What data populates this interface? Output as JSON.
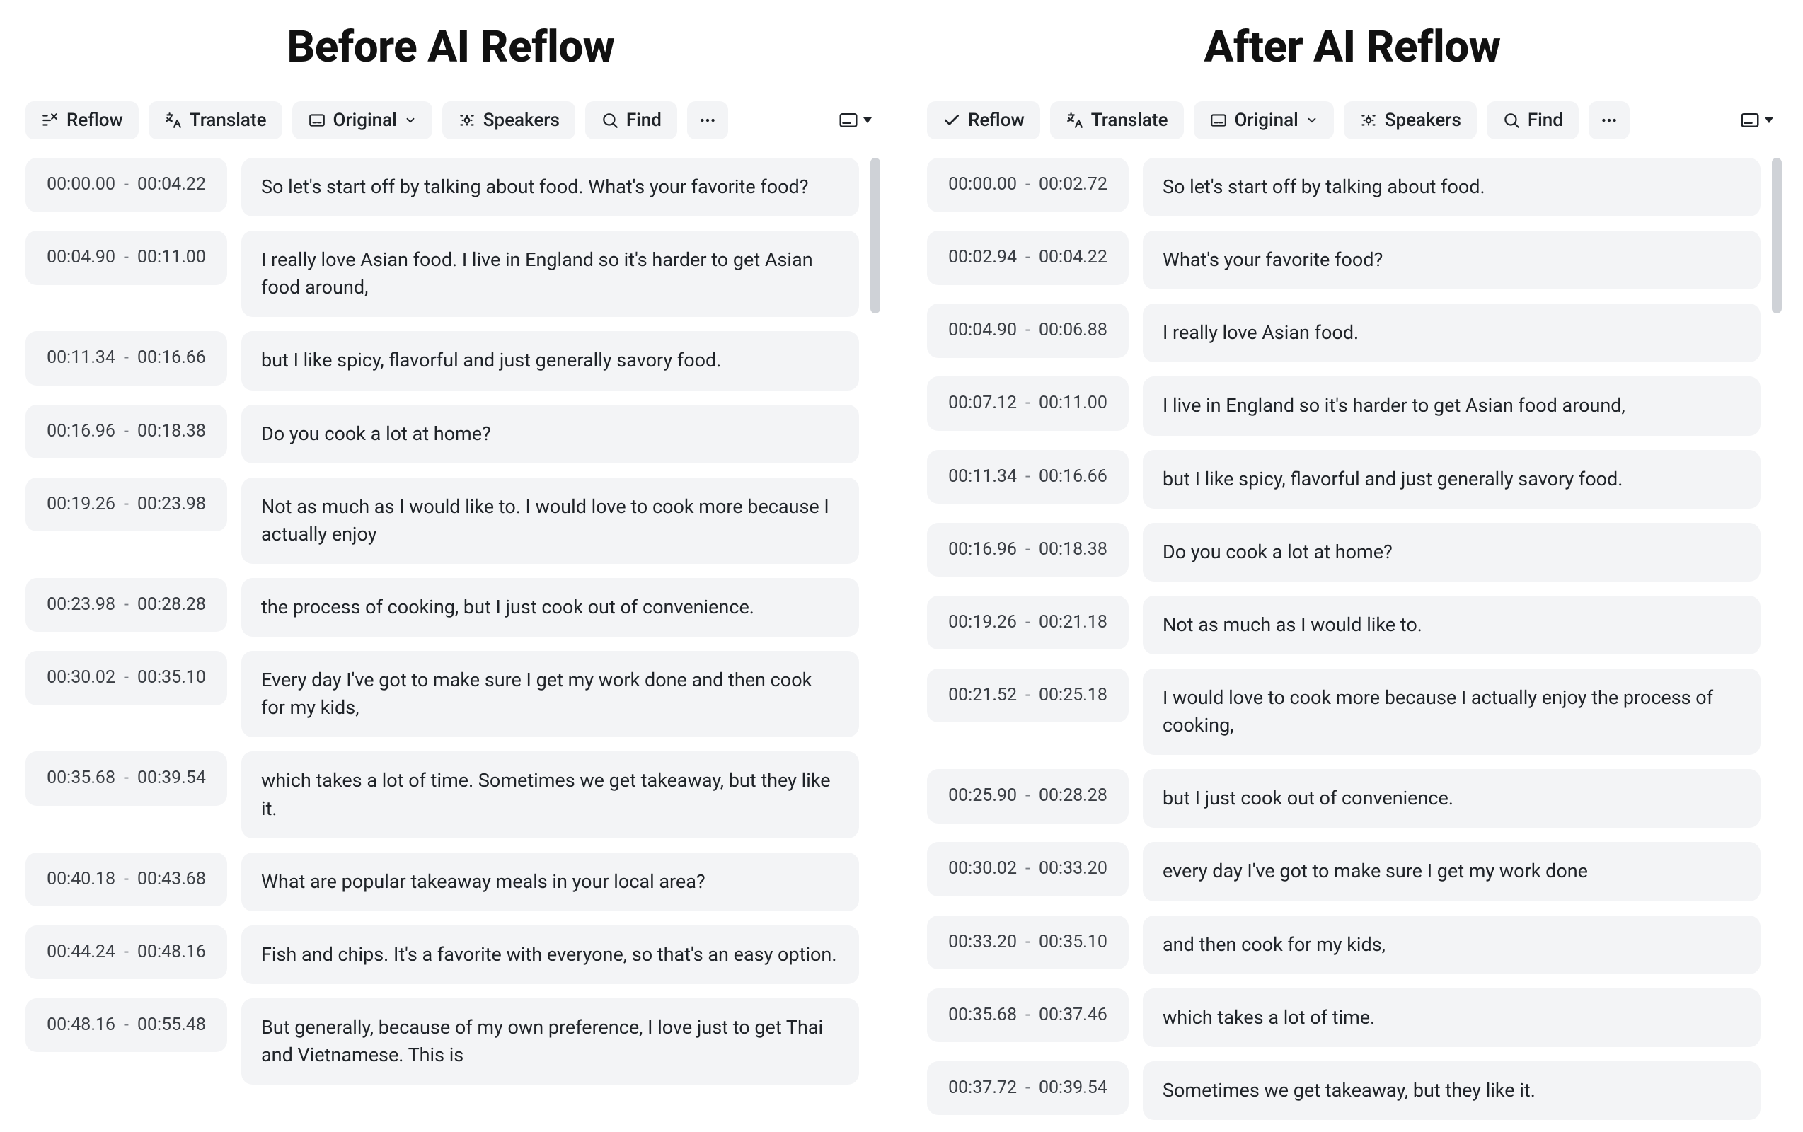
{
  "left": {
    "title": "Before AI Reflow",
    "toolbar": {
      "reflow": "Reflow",
      "translate": "Translate",
      "original": "Original",
      "speakers": "Speakers",
      "find": "Find"
    },
    "rows": [
      {
        "start": "00:00.00",
        "end": "00:04.22",
        "text": "So let's start off by talking about food. What's your favorite food?"
      },
      {
        "start": "00:04.90",
        "end": "00:11.00",
        "text": "I really love Asian food. I live in England so it's harder to get Asian food around,"
      },
      {
        "start": "00:11.34",
        "end": "00:16.66",
        "text": "but I like spicy, flavorful and just generally savory food."
      },
      {
        "start": "00:16.96",
        "end": "00:18.38",
        "text": "Do you cook a lot at home?"
      },
      {
        "start": "00:19.26",
        "end": "00:23.98",
        "text": "Not as much as I would like to. I would love to cook more because I actually enjoy"
      },
      {
        "start": "00:23.98",
        "end": "00:28.28",
        "text": "the process of cooking, but I just cook out of convenience."
      },
      {
        "start": "00:30.02",
        "end": "00:35.10",
        "text": "Every day I've got to make sure I get my work done and then cook for my kids,"
      },
      {
        "start": "00:35.68",
        "end": "00:39.54",
        "text": "which takes a lot of time. Sometimes we get takeaway, but they like it."
      },
      {
        "start": "00:40.18",
        "end": "00:43.68",
        "text": "What are popular takeaway meals in your local area?"
      },
      {
        "start": "00:44.24",
        "end": "00:48.16",
        "text": "Fish and chips. It's a favorite with everyone, so that's an easy option."
      },
      {
        "start": "00:48.16",
        "end": "00:55.48",
        "text": "But generally, because of my own preference, I love just to get Thai and Vietnamese. This is"
      }
    ]
  },
  "right": {
    "title": "After AI Reflow",
    "toolbar": {
      "reflow": "Reflow",
      "translate": "Translate",
      "original": "Original",
      "speakers": "Speakers",
      "find": "Find"
    },
    "rows": [
      {
        "start": "00:00.00",
        "end": "00:02.72",
        "text": "So let's start off by talking about food."
      },
      {
        "start": "00:02.94",
        "end": "00:04.22",
        "text": "What's your favorite food?"
      },
      {
        "start": "00:04.90",
        "end": "00:06.88",
        "text": "I really love Asian food."
      },
      {
        "start": "00:07.12",
        "end": "00:11.00",
        "text": "I live in England so it's harder to get Asian food around,"
      },
      {
        "start": "00:11.34",
        "end": "00:16.66",
        "text": "but I like spicy, flavorful and just generally savory food."
      },
      {
        "start": "00:16.96",
        "end": "00:18.38",
        "text": "Do you cook a lot at home?"
      },
      {
        "start": "00:19.26",
        "end": "00:21.18",
        "text": "Not as much as I would like to."
      },
      {
        "start": "00:21.52",
        "end": "00:25.18",
        "text": "I would love to cook more because I actually enjoy the process of cooking,"
      },
      {
        "start": "00:25.90",
        "end": "00:28.28",
        "text": "but I just cook out of convenience."
      },
      {
        "start": "00:30.02",
        "end": "00:33.20",
        "text": "every day I've got to make sure I get my work done"
      },
      {
        "start": "00:33.20",
        "end": "00:35.10",
        "text": "and then cook for my kids,"
      },
      {
        "start": "00:35.68",
        "end": "00:37.46",
        "text": "which takes a lot of time."
      },
      {
        "start": "00:37.72",
        "end": "00:39.54",
        "text": "Sometimes we get takeaway, but they like it."
      }
    ]
  }
}
